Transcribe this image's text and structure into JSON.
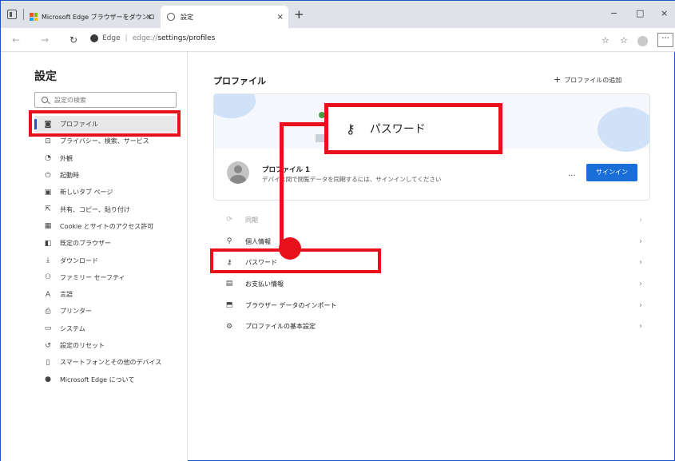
{
  "tabs": [
    {
      "label": "Microsoft Edge ブラウザーをダウンロ",
      "close": "×"
    },
    {
      "label": "設定",
      "close": "×"
    }
  ],
  "new_tab": "+",
  "window_controls": {
    "minimize": "−",
    "maximize": "□",
    "close": "×"
  },
  "address": {
    "label": "Edge",
    "separator": "|",
    "url_prefix": "edge://",
    "url_path": "settings/profiles"
  },
  "toolbar_icons": [
    "reading-view-icon",
    "favorites-icon",
    "profile-icon",
    "more-icon"
  ],
  "sidebar": {
    "title": "設定",
    "search_placeholder": "設定の検索",
    "items": [
      {
        "label": "プロファイル",
        "icon": "profile-icon",
        "active": true
      },
      {
        "label": "プライバシー、検索、サービス",
        "icon": "lock-icon"
      },
      {
        "label": "外観",
        "icon": "appearance-icon"
      },
      {
        "label": "起動時",
        "icon": "power-icon"
      },
      {
        "label": "新しいタブ ページ",
        "icon": "newtab-icon"
      },
      {
        "label": "共有、コピー、貼り付け",
        "icon": "share-icon"
      },
      {
        "label": "Cookie とサイトのアクセス許可",
        "icon": "cookie-icon"
      },
      {
        "label": "既定のブラウザー",
        "icon": "browser-icon"
      },
      {
        "label": "ダウンロード",
        "icon": "download-icon"
      },
      {
        "label": "ファミリー セーフティ",
        "icon": "family-icon"
      },
      {
        "label": "言語",
        "icon": "language-icon"
      },
      {
        "label": "プリンター",
        "icon": "printer-icon"
      },
      {
        "label": "システム",
        "icon": "system-icon"
      },
      {
        "label": "設定のリセット",
        "icon": "reset-icon"
      },
      {
        "label": "スマートフォンとその他のデバイス",
        "icon": "phone-icon"
      },
      {
        "label": "Microsoft Edge について",
        "icon": "edge-icon"
      }
    ]
  },
  "main": {
    "title": "プロファイル",
    "add_profile": "プロファイルの追加",
    "profile": {
      "name": "プロファイル 1",
      "description": "デバイス間で閲覧データを同期するには、サインインしてください",
      "more": "...",
      "signin": "サインイン"
    },
    "settings": [
      {
        "label": "同期",
        "icon": "sync-icon",
        "dim": true
      },
      {
        "label": "個人情報",
        "icon": "person-icon"
      },
      {
        "label": "パスワード",
        "icon": "key-icon"
      },
      {
        "label": "お支払い情報",
        "icon": "card-icon"
      },
      {
        "label": "ブラウザー データのインポート",
        "icon": "import-icon"
      },
      {
        "label": "プロファイルの基本設定",
        "icon": "profile-settings-icon"
      }
    ]
  },
  "callout": {
    "label": "パスワード",
    "icon": "key-icon"
  },
  "colors": {
    "accent": "#1a6ed8",
    "annotation": "#e8101a"
  }
}
